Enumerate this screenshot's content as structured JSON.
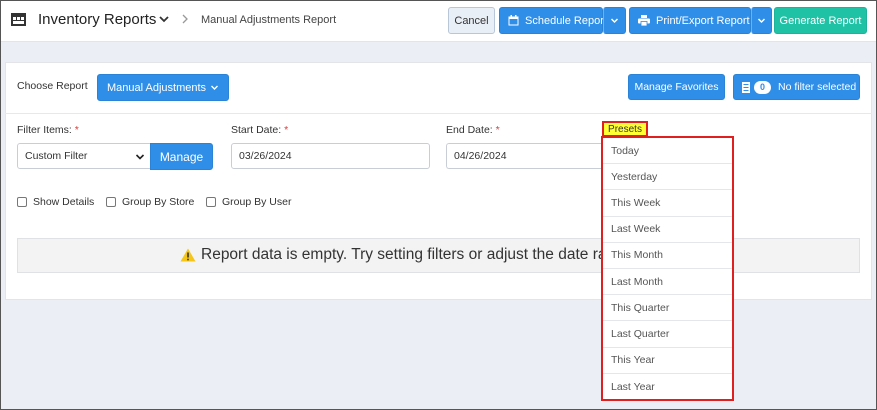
{
  "header": {
    "app_title": "Inventory Reports",
    "breadcrumb": "Manual Adjustments Report",
    "cancel_label": "Cancel",
    "schedule_label": "Schedule Report",
    "print_label": "Print/Export Report",
    "generate_label": "Generate Report"
  },
  "report": {
    "choose_label": "Choose Report",
    "selected_report": "Manual Adjustments",
    "manage_favorites_label": "Manage Favorites",
    "filter_count": "0",
    "filter_status": "No filter selected"
  },
  "filters": {
    "filter_items_label": "Filter Items:",
    "filter_items_value": "Custom Filter",
    "manage_label": "Manage",
    "start_date_label": "Start Date:",
    "start_date_value": "03/26/2024",
    "end_date_label": "End Date:",
    "end_date_value": "04/26/2024",
    "required_mark": "*"
  },
  "options": {
    "show_details": "Show Details",
    "group_by_store": "Group By Store",
    "group_by_user": "Group By User"
  },
  "empty_message": "Report data is empty. Try setting filters or adjust the date range.",
  "presets": {
    "label": "Presets",
    "items": [
      "Today",
      "Yesterday",
      "This Week",
      "Last Week",
      "This Month",
      "Last Month",
      "This Quarter",
      "Last Quarter",
      "This Year",
      "Last Year"
    ]
  },
  "colors": {
    "primary": "#2f8ee8",
    "generate": "#20c2a6",
    "highlight": "#ffff33",
    "annotation": "#e02020",
    "required": "#e03a3a",
    "warning": "#f5c518"
  }
}
